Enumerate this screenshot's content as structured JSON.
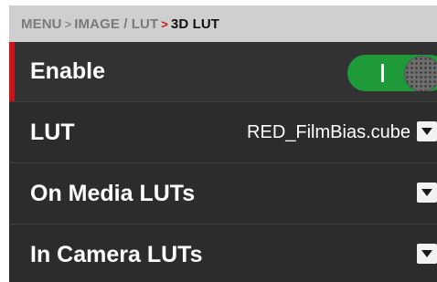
{
  "breadcrumb": {
    "menu": "MENU",
    "image_lut": "IMAGE / LUT",
    "current": "3D LUT",
    "separator": ">",
    "colors": {
      "inactive": "#7a7a7a",
      "active_sep": "#d21414",
      "current": "#111111"
    }
  },
  "rows": {
    "enable": {
      "label": "Enable",
      "toggle_on": true,
      "toggle_color": "#1f9a3a"
    },
    "lut": {
      "label": "LUT",
      "value": "RED_FilmBias.cube",
      "icon": "chevron-down-icon"
    },
    "on_media": {
      "label": "On Media LUTs",
      "icon": "chevron-down-icon"
    },
    "in_camera": {
      "label": "In Camera LUTs",
      "icon": "chevron-down-icon"
    }
  },
  "accent_color": "#c8141a"
}
